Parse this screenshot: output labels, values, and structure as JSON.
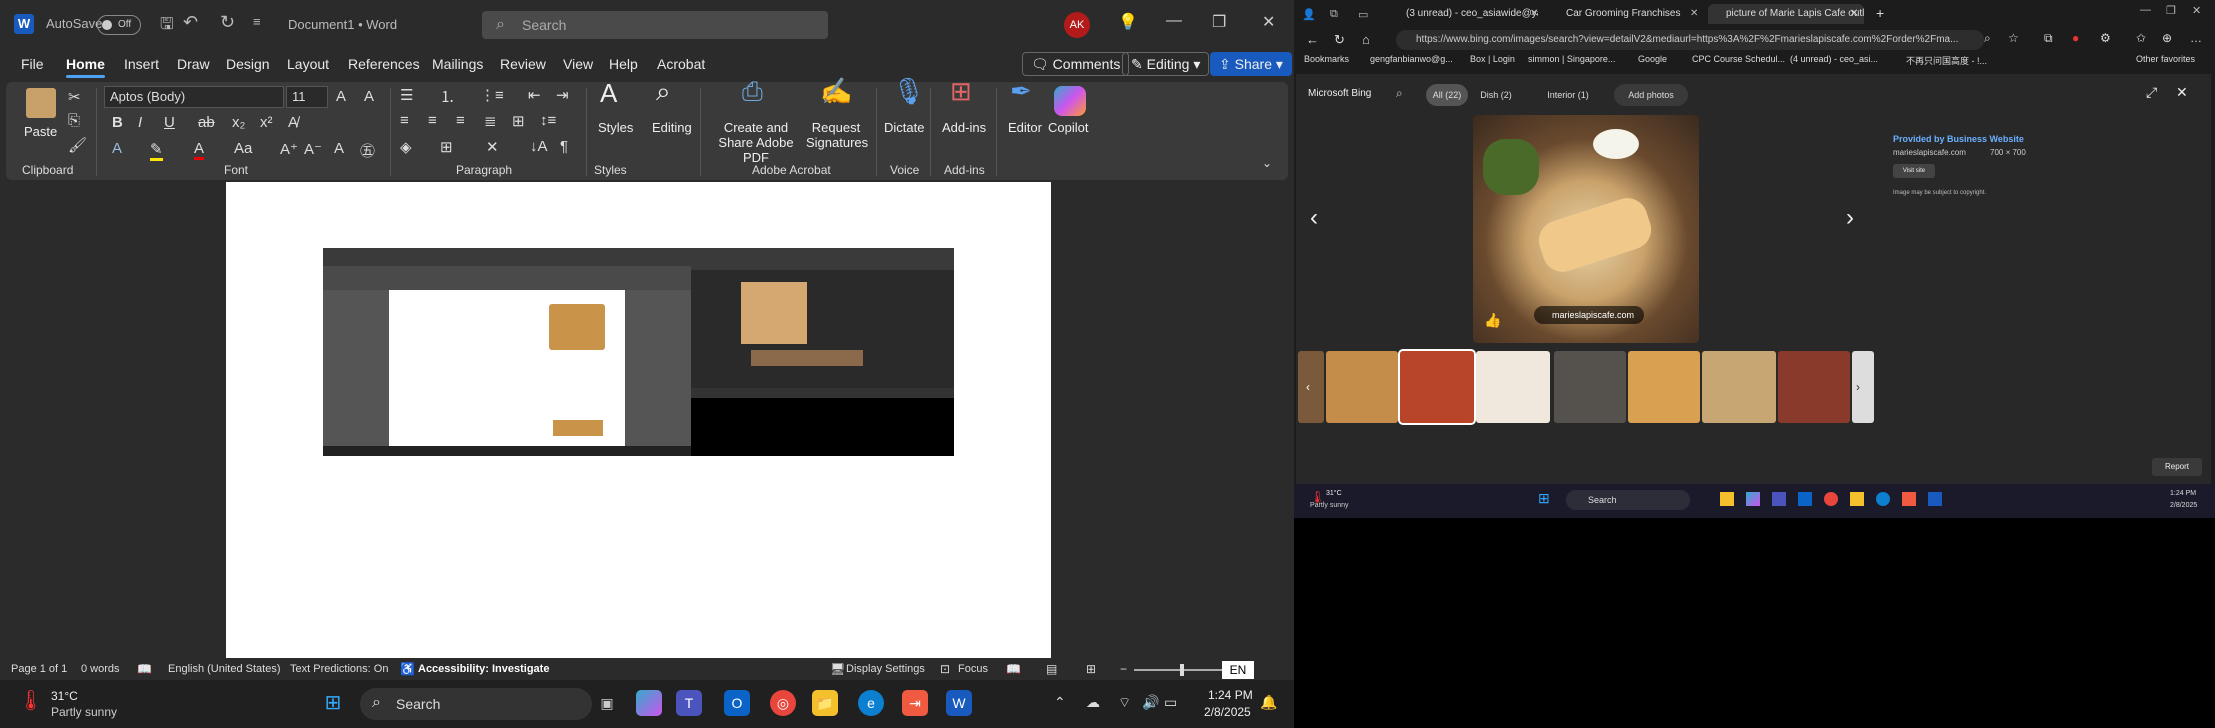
{
  "word": {
    "autosave_label": "AutoSave",
    "autosave_state": "Off",
    "doc_title": "Document1 • Word",
    "search_placeholder": "Search",
    "user_initials": "AK",
    "tabs": [
      "File",
      "Home",
      "Insert",
      "Draw",
      "Design",
      "Layout",
      "References",
      "Mailings",
      "Review",
      "View",
      "Help",
      "Acrobat"
    ],
    "comments_label": "Comments",
    "editing_label": "Editing",
    "share_label": "Share",
    "font_name": "Aptos (Body)",
    "font_size": "11",
    "groups": {
      "clipboard": "Clipboard",
      "font": "Font",
      "paragraph": "Paragraph",
      "styles": "Styles",
      "acrobat": "Adobe Acrobat",
      "voice": "Voice",
      "addins": "Add-ins"
    },
    "buttons": {
      "paste": "Paste",
      "styles": "Styles",
      "editing": "Editing",
      "create_share": "Create and Share Adobe PDF",
      "request_sig": "Request Signatures",
      "dictate": "Dictate",
      "addins": "Add-ins",
      "editor": "Editor",
      "copilot": "Copilot"
    },
    "status": {
      "page": "Page 1 of 1",
      "words": "0 words",
      "lang": "English (United States)",
      "predictions": "Text Predictions: On",
      "accessibility": "Accessibility: Investigate",
      "display": "Display Settings",
      "focus": "Focus",
      "zoom": "EN"
    }
  },
  "taskbar": {
    "weather_temp": "31°C",
    "weather_desc": "Partly sunny",
    "search": "Search",
    "time": "1:24 PM",
    "date": "2/8/2025"
  },
  "edge": {
    "tabs": [
      "(3 unread) - ceo_asiawide@yaho...",
      "Car Grooming Franchises",
      "picture of Marie Lapis Cafe outlet"
    ],
    "url": "https://www.bing.com/images/search?view=detailV2&mediaurl=https%3A%2F%2Fmarieslapiscafe.com%2Forder%2Fma...",
    "bookmarks": [
      "Bookmarks",
      "gengfanbianwo@g...",
      "Box | Login",
      "simmon | Singapore...",
      "Google",
      "CPC Course Schedul...",
      "(4 unread) - ceo_asi...",
      "不再只问国高度 - !...",
      "Other favorites"
    ],
    "bing_brand": "Microsoft Bing",
    "bing_tabs": [
      "All (22)",
      "Dish (2)",
      "Interior (1)",
      "Add photos"
    ],
    "source_title": "Provided by Business Website",
    "source_site": "marieslapiscafe.com",
    "source_dims": "700 × 700",
    "visit_label": "Visit site",
    "copyright": "Image may be subject to copyright.",
    "overlay_site": "marieslapiscafe.com",
    "report": "Report",
    "inner_weather_temp": "31°C",
    "inner_weather_desc": "Partly sunny",
    "inner_search": "Search",
    "inner_time": "1:24 PM",
    "inner_date": "2/8/2025"
  }
}
